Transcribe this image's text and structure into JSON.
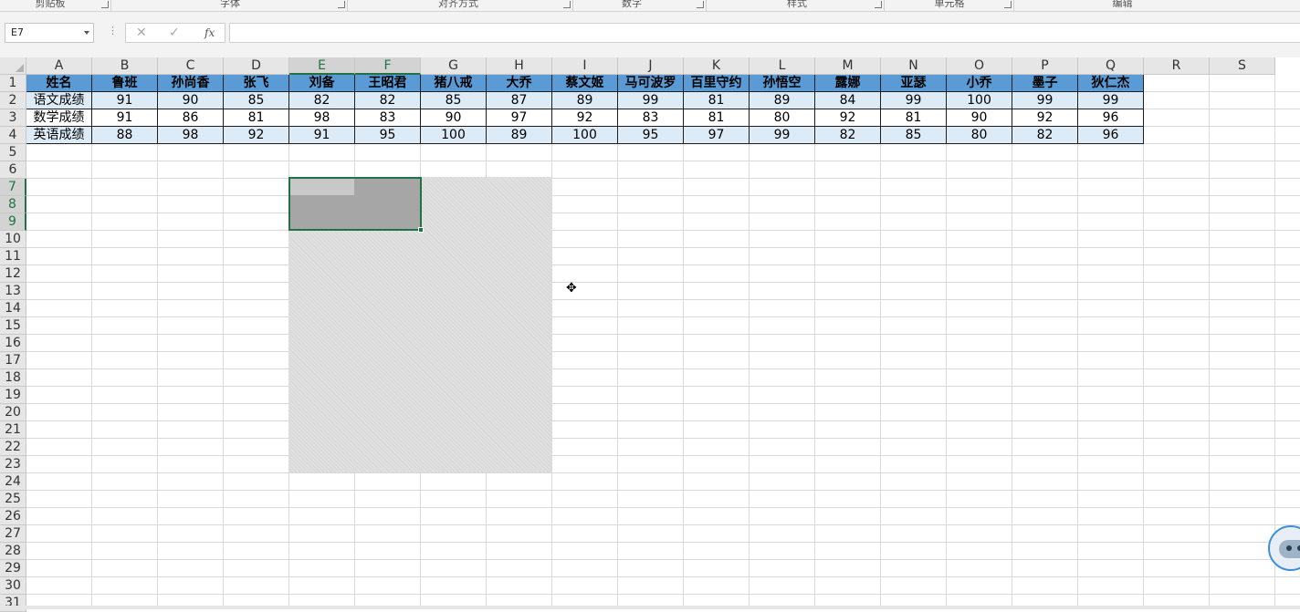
{
  "ribbon": {
    "groups": [
      "剪贴板",
      "字体",
      "对齐方式",
      "数字",
      "样式",
      "单元格",
      "编辑"
    ]
  },
  "formula_bar": {
    "name_box": "E7",
    "cancel_glyph": "✕",
    "enter_glyph": "✓",
    "fx_label": "fx",
    "formula": ""
  },
  "columns": [
    "A",
    "B",
    "C",
    "D",
    "E",
    "F",
    "G",
    "H",
    "I",
    "J",
    "K",
    "L",
    "M",
    "N",
    "O",
    "P",
    "Q",
    "R",
    "S"
  ],
  "selected_columns": [
    "E",
    "F"
  ],
  "rows": [
    "1",
    "2",
    "3",
    "4",
    "5",
    "6",
    "7",
    "8",
    "9",
    "10",
    "11",
    "12",
    "13",
    "14",
    "15",
    "16",
    "17",
    "18",
    "19",
    "20",
    "21",
    "22",
    "23",
    "24",
    "25",
    "26",
    "27",
    "28",
    "29",
    "30",
    "31"
  ],
  "selected_rows": [
    "7",
    "8",
    "9"
  ],
  "table": {
    "header": [
      "姓名",
      "鲁班",
      "孙尚香",
      "张飞",
      "刘备",
      "王昭君",
      "猪八戒",
      "大乔",
      "蔡文姬",
      "马可波罗",
      "百里守约",
      "孙悟空",
      "露娜",
      "亚瑟",
      "小乔",
      "墨子",
      "狄仁杰"
    ],
    "rows": [
      [
        "语文成绩",
        "91",
        "90",
        "85",
        "82",
        "82",
        "85",
        "87",
        "89",
        "99",
        "81",
        "89",
        "84",
        "99",
        "100",
        "99",
        "99"
      ],
      [
        "数学成绩",
        "91",
        "86",
        "81",
        "98",
        "83",
        "90",
        "97",
        "92",
        "83",
        "81",
        "80",
        "92",
        "81",
        "90",
        "92",
        "96"
      ],
      [
        "英语成绩",
        "88",
        "98",
        "92",
        "91",
        "95",
        "100",
        "89",
        "100",
        "95",
        "97",
        "99",
        "82",
        "85",
        "80",
        "82",
        "96"
      ]
    ]
  },
  "selection": {
    "range": "E7:F9"
  },
  "cursor": {
    "icon": "move-cursor-icon"
  },
  "colors": {
    "header_fill": "#5b9bd5",
    "band_fill": "#ddebf7",
    "accent": "#217346"
  }
}
